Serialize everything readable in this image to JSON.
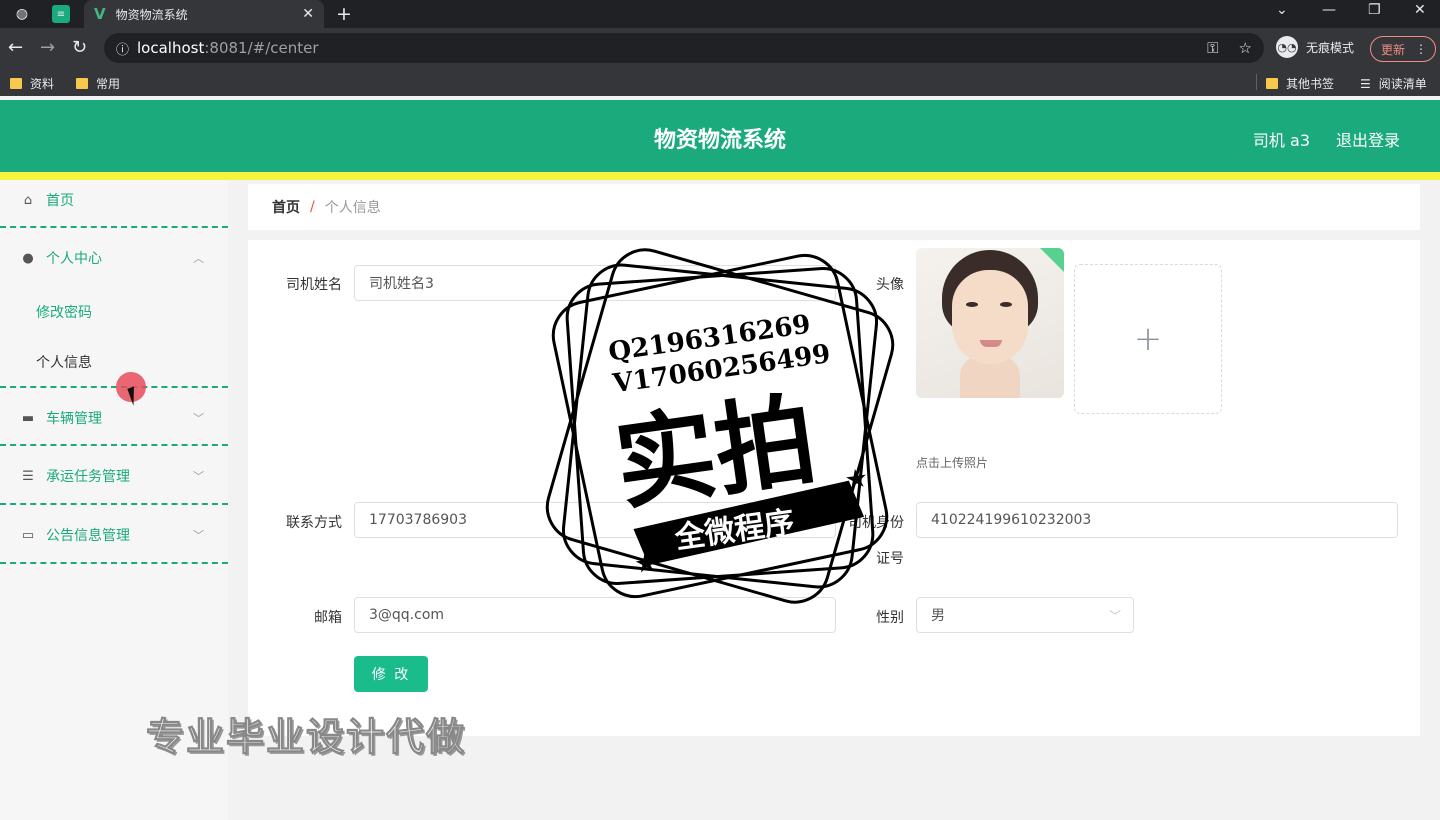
{
  "browser": {
    "tab_title": "物资物流系统",
    "url_host": "localhost",
    "url_rest": ":8081/#/center",
    "incognito_label": "无痕模式",
    "update_label": "更新",
    "bookmarks": [
      "资料",
      "常用"
    ],
    "bookmarks_right": [
      "其他书签",
      "阅读清单"
    ]
  },
  "header": {
    "title": "物资物流系统",
    "user": "司机 a3",
    "logout": "退出登录"
  },
  "sidebar": {
    "home": "首页",
    "personal_center": "个人中心",
    "change_password": "修改密码",
    "personal_info": "个人信息",
    "vehicle_mgmt": "车辆管理",
    "task_mgmt": "承运任务管理",
    "notice_mgmt": "公告信息管理"
  },
  "breadcrumb": {
    "home": "首页",
    "separator": "/",
    "current": "个人信息"
  },
  "form": {
    "name_label": "司机姓名",
    "name_value": "司机姓名3",
    "avatar_label": "头像",
    "upload_hint": "点击上传照片",
    "phone_label": "联系方式",
    "phone_value": "17703786903",
    "id_label_1": "司机身份",
    "id_label_2": "证号",
    "id_value": "410224199610232003",
    "email_label": "邮箱",
    "email_value": "3@qq.com",
    "gender_label": "性别",
    "gender_value": "男",
    "submit": "修 改"
  },
  "watermark": {
    "stamp_line1": "Q2196316269",
    "stamp_line2": "V17060256499",
    "stamp_main": "实拍",
    "stamp_banner": "全微程序",
    "bottom_text": "专业毕业设计代做"
  },
  "colors": {
    "header": "#1aaa7c",
    "stripe": "#f4f43c",
    "button": "#1abc8c"
  }
}
